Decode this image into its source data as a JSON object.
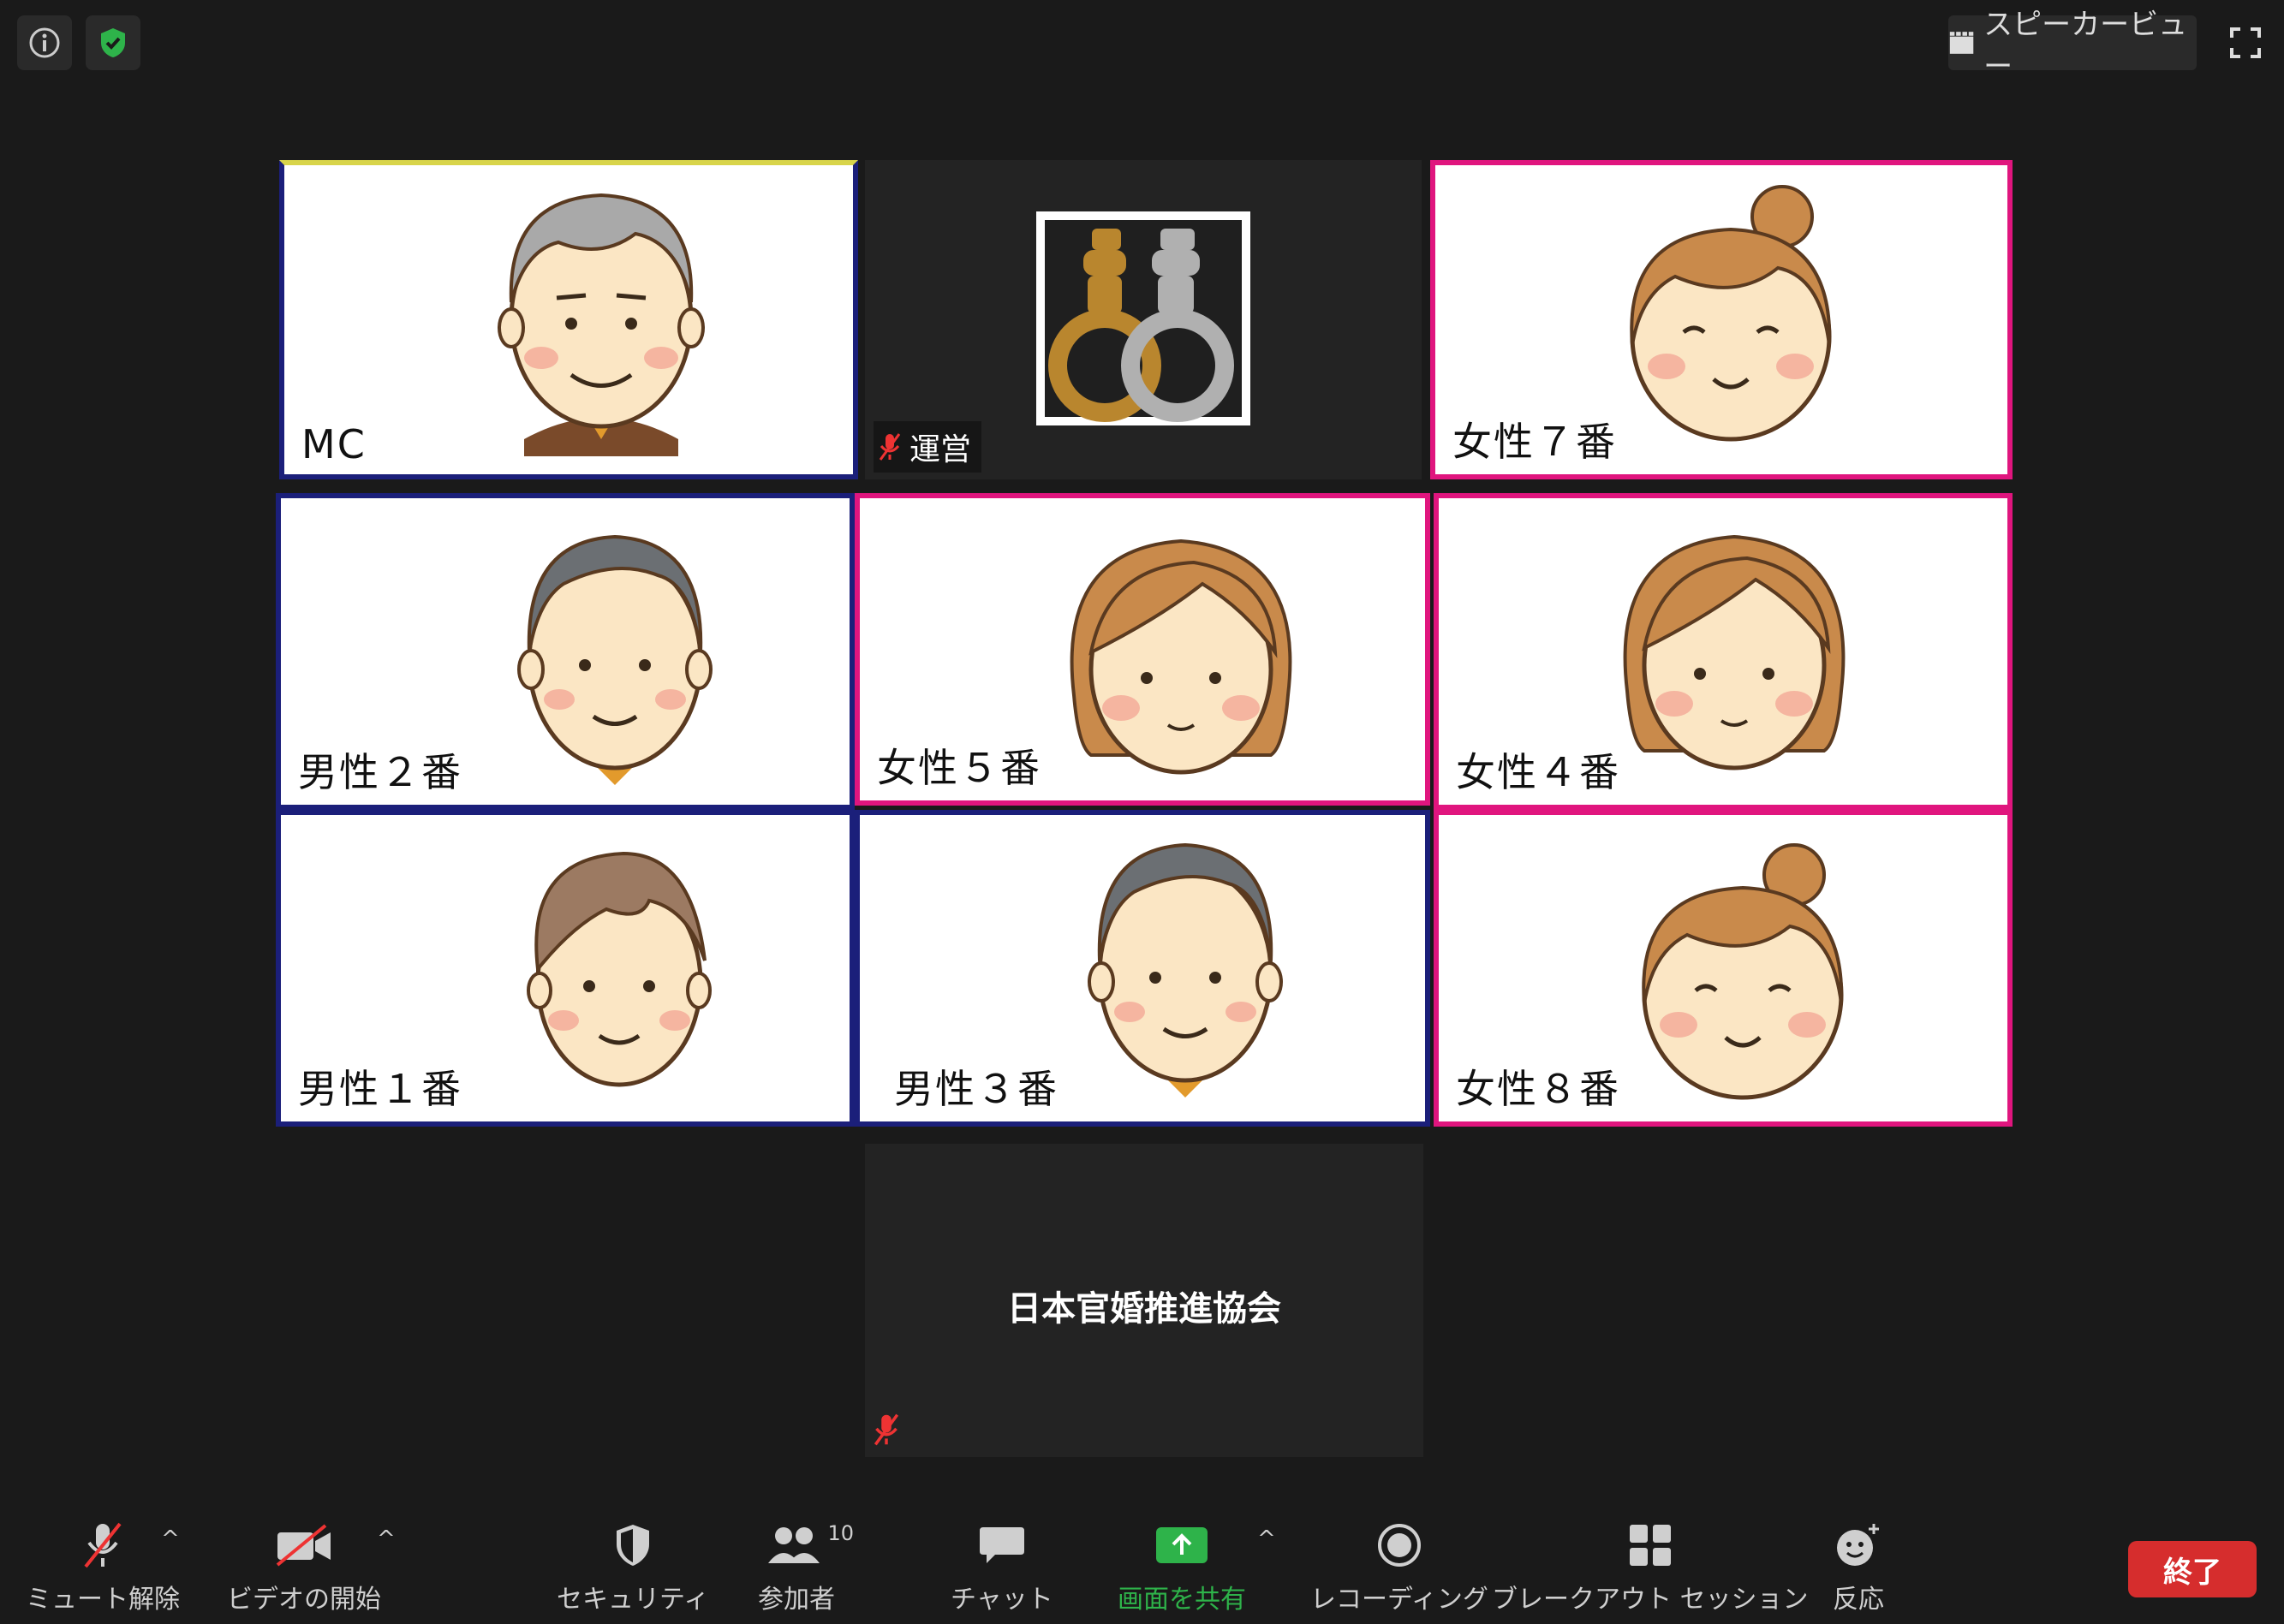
{
  "topbar": {
    "view_label": "スピーカービュー"
  },
  "tiles": {
    "mc": "MC",
    "unei": "運営",
    "f7": "女性７番",
    "m2": "男性２番",
    "f5": "女性５番",
    "f4": "女性４番",
    "m1": "男性１番",
    "m3": "男性３番",
    "f8": "女性８番",
    "kyoukai": "日本官婚推進協会"
  },
  "toolbar": {
    "mute": "ミュート解除",
    "video": "ビデオの開始",
    "security": "セキュリティ",
    "participants": "参加者",
    "participants_count": "10",
    "chat": "チャット",
    "share": "画面を共有",
    "record": "レコーディング",
    "breakout": "ブレークアウト セッション",
    "reactions": "反応",
    "end": "終了"
  },
  "colors": {
    "male_border": "#1b1f7a",
    "female_border": "#e0157e",
    "share_green": "#2eb34a",
    "end_red": "#d62d2d"
  }
}
